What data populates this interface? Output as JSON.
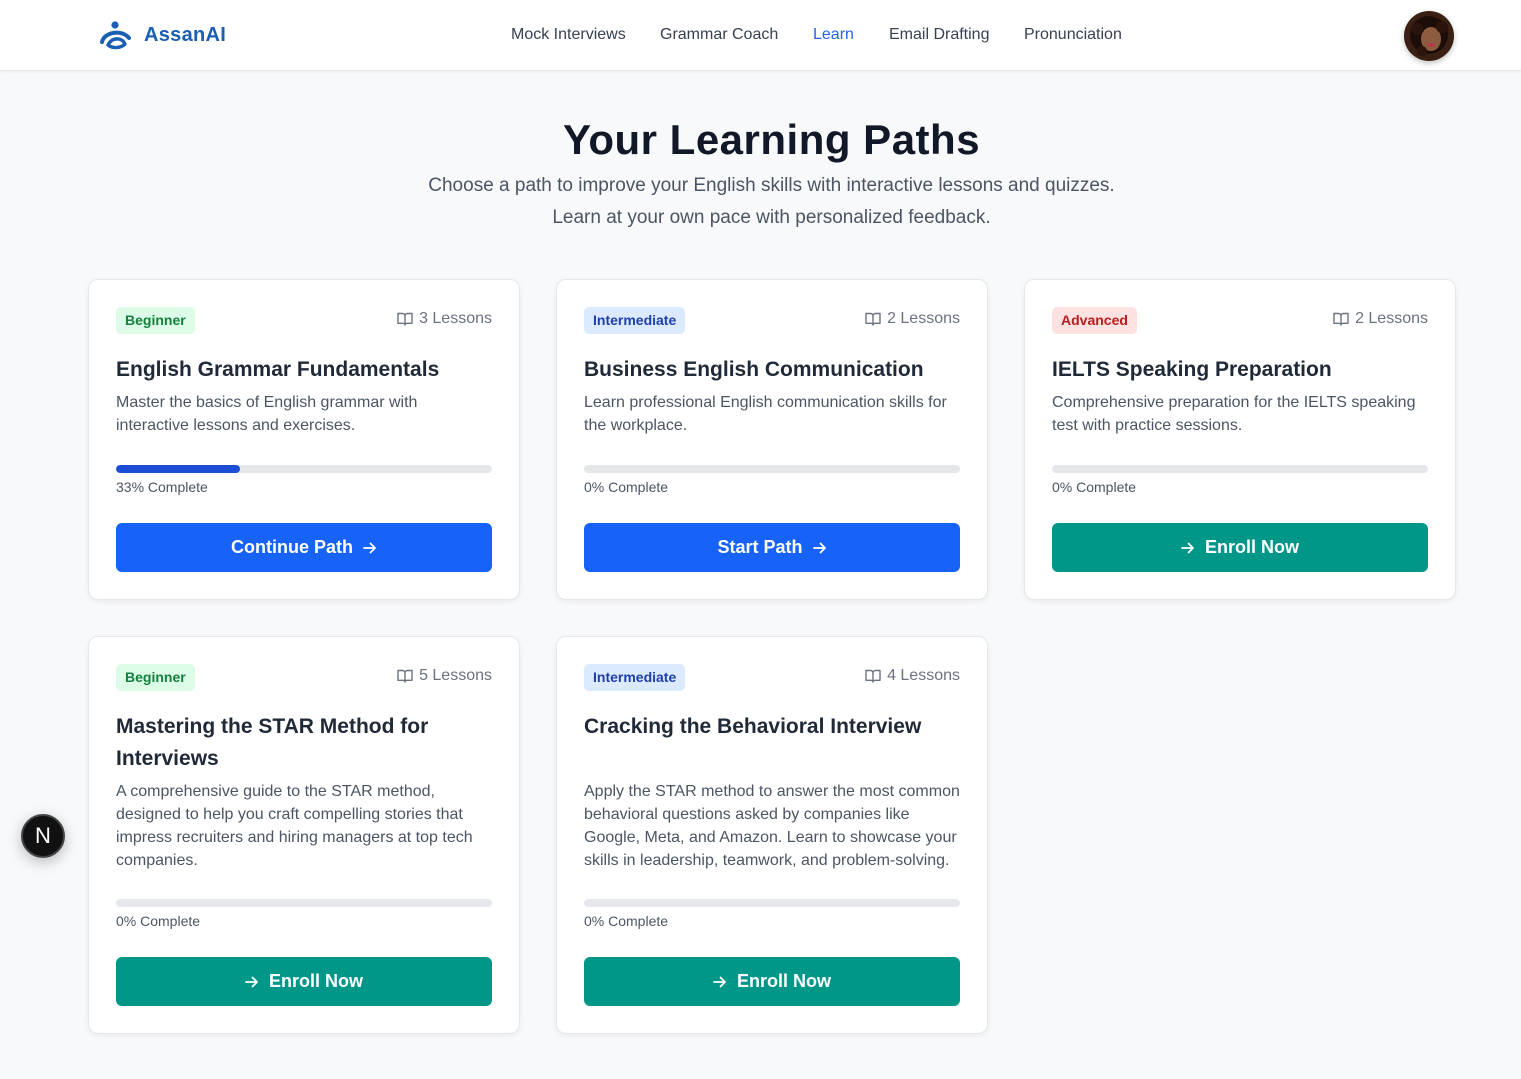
{
  "brand": {
    "name": "AssanAI"
  },
  "nav": [
    {
      "label": "Mock Interviews",
      "active": false
    },
    {
      "label": "Grammar Coach",
      "active": false
    },
    {
      "label": "Learn",
      "active": true
    },
    {
      "label": "Email Drafting",
      "active": false
    },
    {
      "label": "Pronunciation",
      "active": false
    }
  ],
  "header": {
    "title": "Your Learning Paths",
    "subtitle_line1": "Choose a path to improve your English skills with interactive lessons and quizzes.",
    "subtitle_line2": "Learn at your own pace with personalized feedback."
  },
  "paths": [
    {
      "level": "Beginner",
      "lessons": "3 Lessons",
      "title": "English Grammar Fundamentals",
      "description": "Master the basics of English grammar with interactive lessons and exercises.",
      "progress": 0.33,
      "progress_label": "33% Complete",
      "button": "Continue Path",
      "button_style": "blue"
    },
    {
      "level": "Intermediate",
      "lessons": "2 Lessons",
      "title": "Business English Communication",
      "description": "Learn professional English communication skills for the workplace.",
      "progress": 0,
      "progress_label": "0% Complete",
      "button": "Start Path",
      "button_style": "blue"
    },
    {
      "level": "Advanced",
      "lessons": "2 Lessons",
      "title": "IELTS Speaking Preparation",
      "description": "Comprehensive preparation for the IELTS speaking test with practice sessions.",
      "progress": 0,
      "progress_label": "0% Complete",
      "button": "Enroll Now",
      "button_style": "teal"
    },
    {
      "level": "Beginner",
      "lessons": "5 Lessons",
      "title": "Mastering the STAR Method for Interviews",
      "description": "A comprehensive guide to the STAR method, designed to help you craft compelling stories that impress recruiters and hiring managers at top tech companies.",
      "progress": 0,
      "progress_label": "0% Complete",
      "button": "Enroll Now",
      "button_style": "teal"
    },
    {
      "level": "Intermediate",
      "lessons": "4 Lessons",
      "title": "Cracking the Behavioral Interview",
      "description": "Apply the STAR method to answer the most common behavioral questions asked by companies like Google, Meta, and Amazon. Learn to showcase your skills in leadership, teamwork, and problem-solving.",
      "progress": 0,
      "progress_label": "0% Complete",
      "button": "Enroll Now",
      "button_style": "teal"
    }
  ],
  "dev_badge": {
    "letter": "N"
  },
  "colors": {
    "primary_blue": "#1763f7",
    "teal": "#009688",
    "brand_blue": "#1a5fb4"
  },
  "icons": {
    "lessons": "book-open-icon",
    "arrow": "arrow-right-icon"
  }
}
